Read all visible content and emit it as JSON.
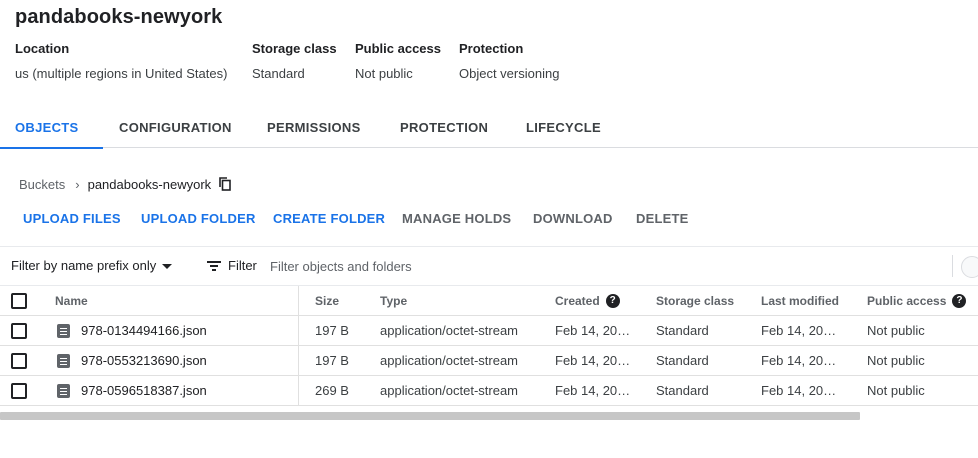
{
  "bucket": {
    "name": "pandabooks-newyork"
  },
  "meta": [
    {
      "label": "Location",
      "value": "us (multiple regions in United States)"
    },
    {
      "label": "Storage class",
      "value": "Standard"
    },
    {
      "label": "Public access",
      "value": "Not public"
    },
    {
      "label": "Protection",
      "value": "Object versioning"
    }
  ],
  "tabs": [
    {
      "label": "OBJECTS",
      "active": true
    },
    {
      "label": "CONFIGURATION",
      "active": false
    },
    {
      "label": "PERMISSIONS",
      "active": false
    },
    {
      "label": "PROTECTION",
      "active": false
    },
    {
      "label": "LIFECYCLE",
      "active": false
    }
  ],
  "breadcrumb": {
    "root": "Buckets",
    "separator": "›",
    "current": "pandabooks-newyork",
    "copy_icon": "copy-icon"
  },
  "actions": [
    {
      "label": "UPLOAD FILES",
      "enabled": true
    },
    {
      "label": "UPLOAD FOLDER",
      "enabled": true
    },
    {
      "label": "CREATE FOLDER",
      "enabled": true
    },
    {
      "label": "MANAGE HOLDS",
      "enabled": false
    },
    {
      "label": "DOWNLOAD",
      "enabled": false
    },
    {
      "label": "DELETE",
      "enabled": false
    }
  ],
  "filter": {
    "mode_label": "Filter by name prefix only",
    "button_label": "Filter",
    "placeholder": "Filter objects and folders"
  },
  "table": {
    "headers": {
      "name": "Name",
      "size": "Size",
      "type": "Type",
      "created": "Created",
      "storage_class": "Storage class",
      "last_modified": "Last modified",
      "public_access": "Public access"
    },
    "rows": [
      {
        "name": "978-0134494166.json",
        "size": "197 B",
        "type": "application/octet-stream",
        "created": "Feb 14, 20…",
        "storage_class": "Standard",
        "last_modified": "Feb 14, 20…",
        "public_access": "Not public"
      },
      {
        "name": "978-0553213690.json",
        "size": "197 B",
        "type": "application/octet-stream",
        "created": "Feb 14, 20…",
        "storage_class": "Standard",
        "last_modified": "Feb 14, 20…",
        "public_access": "Not public"
      },
      {
        "name": "978-0596518387.json",
        "size": "269 B",
        "type": "application/octet-stream",
        "created": "Feb 14, 20…",
        "storage_class": "Standard",
        "last_modified": "Feb 14, 20…",
        "public_access": "Not public"
      }
    ]
  },
  "colors": {
    "accent": "#1a73e8",
    "text": "#202124",
    "muted": "#5f6368",
    "border": "#e0e0e0"
  }
}
